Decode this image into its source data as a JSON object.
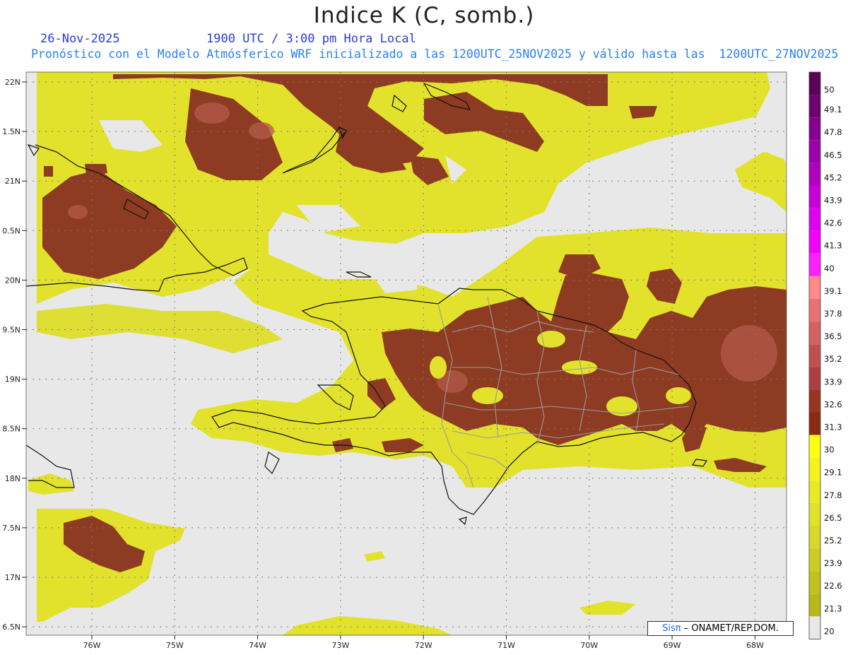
{
  "header": {
    "title": "Indice K (C, somb.)",
    "date": "26-Nov-2025",
    "valid_time": "1900 UTC / 3:00 pm Hora Local",
    "description": "Pronóstico con el Modelo Atmósferico WRF inicializado a las 1200UTC_25NOV2025 y válido hasta las  1200UTC_27NOV2025"
  },
  "axes": {
    "lat_labels": [
      "22N",
      "1.5N",
      "21N",
      "0.5N",
      "20N",
      "9.5N",
      "19N",
      "8.5N",
      "18N",
      "7.5N",
      "17N",
      "6.5N"
    ],
    "lon_labels": [
      "76W",
      "75W",
      "74W",
      "73W",
      "72W",
      "71W",
      "70W",
      "69W",
      "68W"
    ]
  },
  "colorbar": {
    "labels": [
      "50",
      "49.1",
      "47.8",
      "46.5",
      "45.2",
      "43.9",
      "42.6",
      "41.3",
      "40",
      "39.1",
      "37.8",
      "36.5",
      "35.2",
      "33.9",
      "32.6",
      "31.3",
      "30",
      "29.1",
      "27.8",
      "26.5",
      "25.2",
      "23.9",
      "22.6",
      "21.3",
      "20"
    ],
    "colors": [
      "#5a0057",
      "#6c0070",
      "#82008c",
      "#9a00a8",
      "#b000c0",
      "#c800d8",
      "#e000ee",
      "#f200f8",
      "#ff20ff",
      "#ff8a8a",
      "#e87272",
      "#d46060",
      "#c05050",
      "#ac4040",
      "#983424",
      "#872b12",
      "#ffff10",
      "#f4f41c",
      "#eaea24",
      "#e2e22a",
      "#d8d82a",
      "#cccc24",
      "#c2c21e",
      "#b8b81a",
      "#e8e8e8"
    ]
  },
  "credit": {
    "logo": "Sisπ",
    "text": "– ONAMET/REP.DOM."
  },
  "colors": {
    "background": "#e8e8e8",
    "yellow": "#e6e62a",
    "brown": "#8c3a1e",
    "border": "#111111"
  }
}
